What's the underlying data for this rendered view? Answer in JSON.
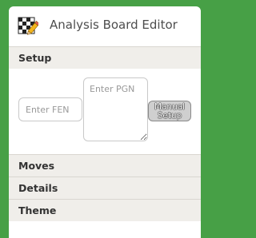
{
  "header": {
    "title": "Analysis Board Editor",
    "logo_icon": "chessboard-pencil-icon"
  },
  "sections": {
    "setup": "Setup",
    "moves": "Moves",
    "details": "Details",
    "theme": "Theme"
  },
  "setup": {
    "fen_placeholder": "Enter FEN",
    "pgn_placeholder": "Enter PGN",
    "manual_setup_line1": "Manual",
    "manual_setup_line2": "Setup"
  },
  "colors": {
    "background": "#47a046",
    "section_header": "#f0eeea"
  }
}
